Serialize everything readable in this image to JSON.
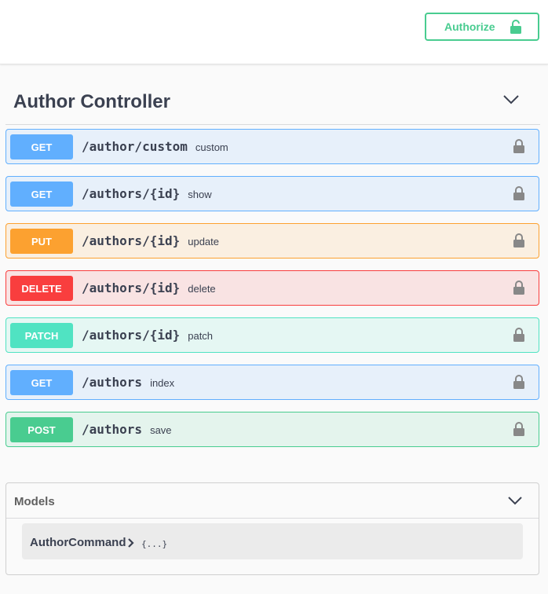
{
  "header": {
    "authorize_label": "Authorize",
    "authorize_icon": "unlocked-lock-icon",
    "accent_color": "#49cc90"
  },
  "section": {
    "title": "Author Controller",
    "chevron_icon": "chevron-down-icon"
  },
  "operations": [
    {
      "method": "GET",
      "path": "/author/custom",
      "summary": "custom",
      "color": "#61affe"
    },
    {
      "method": "GET",
      "path": "/authors/{id}",
      "summary": "show",
      "color": "#61affe"
    },
    {
      "method": "PUT",
      "path": "/authors/{id}",
      "summary": "update",
      "color": "#fca130"
    },
    {
      "method": "DELETE",
      "path": "/authors/{id}",
      "summary": "delete",
      "color": "#f93e3e"
    },
    {
      "method": "PATCH",
      "path": "/authors/{id}",
      "summary": "patch",
      "color": "#50e3c2"
    },
    {
      "method": "GET",
      "path": "/authors",
      "summary": "index",
      "color": "#61affe"
    },
    {
      "method": "POST",
      "path": "/authors",
      "summary": "save",
      "color": "#49cc90"
    }
  ],
  "models": {
    "title": "Models",
    "items": [
      {
        "name": "AuthorCommand",
        "expand": "{...}"
      }
    ]
  }
}
